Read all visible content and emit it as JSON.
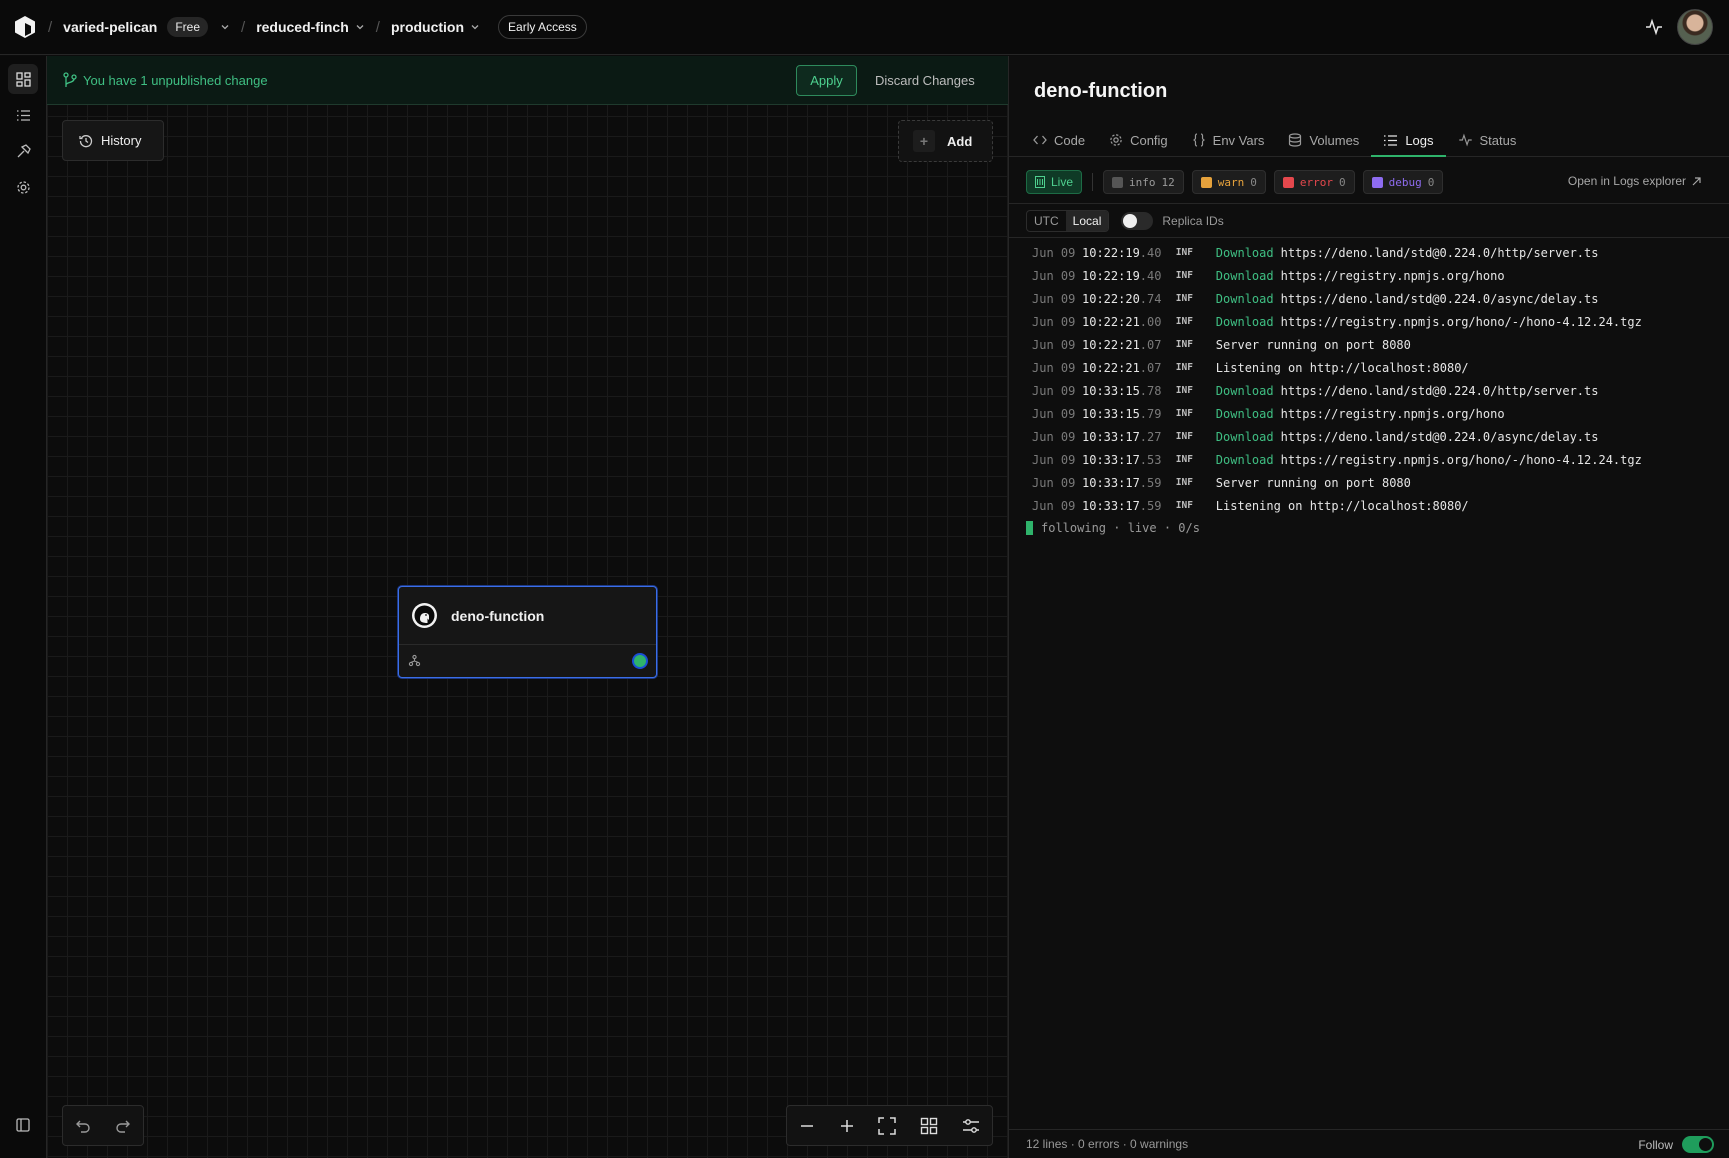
{
  "header": {
    "workspace": "varied-pelican",
    "plan": "Free",
    "project": "reduced-finch",
    "environment": "production",
    "early_access": "Early Access"
  },
  "canvas": {
    "change_notice": "You have 1 unpublished change",
    "apply_label": "Apply",
    "discard_label": "Discard Changes",
    "history_label": "History",
    "add_label": "Add",
    "node": {
      "title": "deno-function",
      "status_color": "#2fb36b"
    }
  },
  "panel": {
    "title": "deno-function",
    "tabs": [
      {
        "label": "Code",
        "icon": "code-icon"
      },
      {
        "label": "Config",
        "icon": "gear-icon"
      },
      {
        "label": "Env Vars",
        "icon": "braces-icon"
      },
      {
        "label": "Volumes",
        "icon": "database-icon"
      },
      {
        "label": "Logs",
        "icon": "list-icon",
        "active": true
      },
      {
        "label": "Status",
        "icon": "pulse-icon"
      }
    ],
    "live_label": "Live",
    "filters": {
      "info": {
        "label": "info",
        "count": "12"
      },
      "warn": {
        "label": "warn",
        "count": "0"
      },
      "error": {
        "label": "error",
        "count": "0"
      },
      "debug": {
        "label": "debug",
        "count": "0"
      }
    },
    "open_logs_label": "Open in Logs explorer",
    "tz": {
      "utc": "UTC",
      "local": "Local"
    },
    "replica_label": "Replica IDs",
    "logs": [
      {
        "date": "Jun 09",
        "time": "10:22:19",
        "frac": ".40",
        "level": "INF",
        "kw": "Download",
        "msg": "https://deno.land/std@0.224.0/http/server.ts"
      },
      {
        "date": "Jun 09",
        "time": "10:22:19",
        "frac": ".40",
        "level": "INF",
        "kw": "Download",
        "msg": "https://registry.npmjs.org/hono"
      },
      {
        "date": "Jun 09",
        "time": "10:22:20",
        "frac": ".74",
        "level": "INF",
        "kw": "Download",
        "msg": "https://deno.land/std@0.224.0/async/delay.ts"
      },
      {
        "date": "Jun 09",
        "time": "10:22:21",
        "frac": ".00",
        "level": "INF",
        "kw": "Download",
        "msg": "https://registry.npmjs.org/hono/-/hono-4.12.24.tgz"
      },
      {
        "date": "Jun 09",
        "time": "10:22:21",
        "frac": ".07",
        "level": "INF",
        "kw": "",
        "msg": "Server running on port 8080"
      },
      {
        "date": "Jun 09",
        "time": "10:22:21",
        "frac": ".07",
        "level": "INF",
        "kw": "",
        "msg": "Listening on http://localhost:8080/"
      },
      {
        "date": "Jun 09",
        "time": "10:33:15",
        "frac": ".78",
        "level": "INF",
        "kw": "Download",
        "msg": "https://deno.land/std@0.224.0/http/server.ts"
      },
      {
        "date": "Jun 09",
        "time": "10:33:15",
        "frac": ".79",
        "level": "INF",
        "kw": "Download",
        "msg": "https://registry.npmjs.org/hono"
      },
      {
        "date": "Jun 09",
        "time": "10:33:17",
        "frac": ".27",
        "level": "INF",
        "kw": "Download",
        "msg": "https://deno.land/std@0.224.0/async/delay.ts"
      },
      {
        "date": "Jun 09",
        "time": "10:33:17",
        "frac": ".53",
        "level": "INF",
        "kw": "Download",
        "msg": "https://registry.npmjs.org/hono/-/hono-4.12.24.tgz"
      },
      {
        "date": "Jun 09",
        "time": "10:33:17",
        "frac": ".59",
        "level": "INF",
        "kw": "",
        "msg": "Server running on port 8080"
      },
      {
        "date": "Jun 09",
        "time": "10:33:17",
        "frac": ".59",
        "level": "INF",
        "kw": "",
        "msg": "Listening on http://localhost:8080/"
      }
    ],
    "following": "following · live · 0/s",
    "footer_stats": "12 lines · 0 errors · 0 warnings",
    "follow_label": "Follow"
  },
  "colors": {
    "accent": "#2fb36b",
    "node_border": "#3b6ee8",
    "warn": "#e6a23c",
    "error": "#e5484d",
    "debug": "#8e6cf0"
  }
}
